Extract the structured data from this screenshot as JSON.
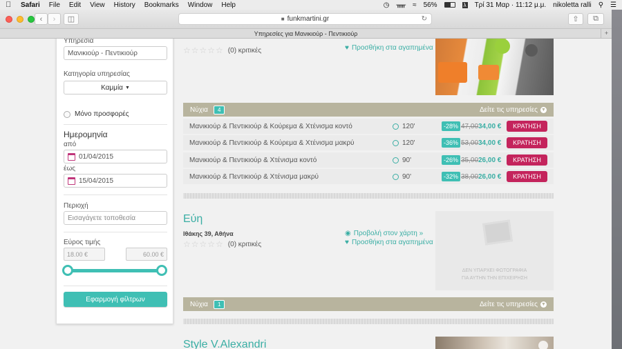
{
  "menubar": {
    "app": "Safari",
    "items": [
      "File",
      "Edit",
      "View",
      "History",
      "Bookmarks",
      "Window",
      "Help"
    ],
    "battery": "56%",
    "datetime": "Τρί 31 Μαρ · 11:12 μ.μ.",
    "user": "nikoletta ralli"
  },
  "browser": {
    "url": "funkmartini.gr",
    "tab_title": "Υπηρεσίες για Μανικιούρ - Πεντικιούρ"
  },
  "sidebar": {
    "service_label": "Υπηρεσία",
    "service_value": "Μανικιούρ - Πεντικιούρ",
    "category_label": "Κατηγορία υπηρεσίας",
    "category_value": "Καμμία",
    "offers_label": "Μόνο προσφορές",
    "date_heading": "Ημερομηνία",
    "from_label": "από",
    "from_value": "01/04/2015",
    "to_label": "έως",
    "to_value": "15/04/2015",
    "area_label": "Περιοχή",
    "area_placeholder": "Εισαγάγετε τοποθεσία",
    "price_label": "Εύρος τιμής",
    "price_min": "18.00 €",
    "price_max": "60.00 €",
    "apply_label": "Εφαρμογή φίλτρων"
  },
  "first_business": {
    "reviews": "(0) κριτικές",
    "favorite_label": "Προσθήκη στα αγαπημένα",
    "section_title": "Νύχια",
    "section_count": "4",
    "see_services": "Δείτε τις υπηρεσίες",
    "services": [
      {
        "name": "Μανικιούρ & Πεντικιούρ & Κούρεμα & Χτένισμα κοντό",
        "duration": "120'",
        "discount": "-28%",
        "old_price": "47,00",
        "new_price": "34,00 €",
        "book": "ΚΡΑΤΗΣΗ"
      },
      {
        "name": "Μανικιούρ & Πεντικιούρ & Κούρεμα & Χτένισμα μακρύ",
        "duration": "120'",
        "discount": "-36%",
        "old_price": "53,00",
        "new_price": "34,00 €",
        "book": "ΚΡΑΤΗΣΗ"
      },
      {
        "name": "Μανικιούρ & Πεντικιούρ & Χτένισμα κοντό",
        "duration": "90'",
        "discount": "-26%",
        "old_price": "35,00",
        "new_price": "26,00 €",
        "book": "ΚΡΑΤΗΣΗ"
      },
      {
        "name": "Μανικιούρ & Πεντικιούρ & Χτένισμα μακρύ",
        "duration": "90'",
        "discount": "-32%",
        "old_price": "38,00",
        "new_price": "26,00 €",
        "book": "ΚΡΑΤΗΣΗ"
      }
    ]
  },
  "second_business": {
    "name": "Εύη",
    "address": "Ιθάκης 39, Αθήνα",
    "reviews": "(0) κριτικές",
    "map_label": "Προβολή στον χάρτη »",
    "favorite_label": "Προσθήκη στα αγαπημένα",
    "no_photo_line1": "ΔΕΝ ΥΠΑΡΧΕΙ ΦΩΤΟΓΡΑΦΙΑ",
    "no_photo_line2": "ΓΙΑ ΑΥΤΗΝ ΤΗΝ ΕΠΙΧΕΙΡΗΣΗ",
    "section_title": "Νύχια",
    "section_count": "1",
    "see_services": "Δείτε τις υπηρεσίες"
  },
  "third_business": {
    "name": "Style V.Alexandri"
  },
  "colors": {
    "accent": "#3fbfb4",
    "book_button": "#c4245c",
    "section_bar": "#b8b49e"
  }
}
